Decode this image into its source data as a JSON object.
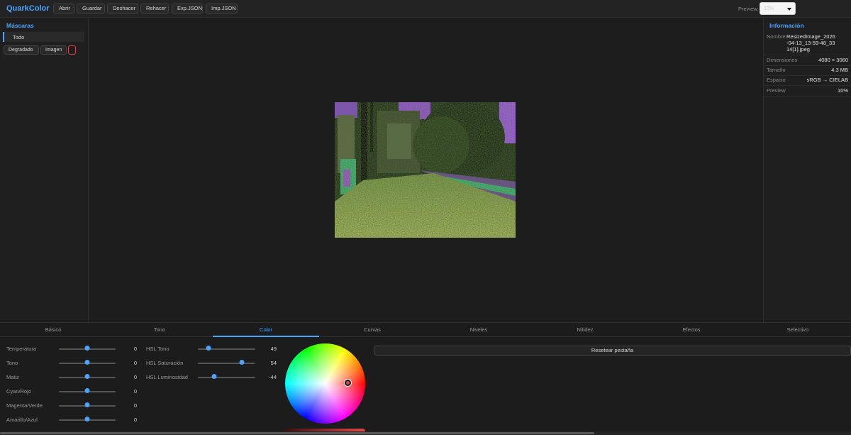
{
  "app": {
    "brand": "QuarkColor"
  },
  "toolbar": {
    "buttons": [
      "Abrir",
      "Guardar",
      "Deshacer",
      "Rehacer",
      "Exp.JSON",
      "Imp.JSON"
    ],
    "preview_label": "Preview:",
    "preview_value": "10%"
  },
  "masks": {
    "title": "Máscaras",
    "items": [
      "Todo"
    ],
    "buttons": [
      "Degradado",
      "Imagen"
    ]
  },
  "info": {
    "title": "Información",
    "rows": [
      {
        "key": "Nombre",
        "value": "ResizedImage_2026-04-13_13-59-48_3314[1].jpeg"
      },
      {
        "key": "Dimensiones",
        "value": "4080 × 3060"
      },
      {
        "key": "Tamaño",
        "value": "4.3 MB"
      },
      {
        "key": "Espacio",
        "value": "sRGB → CIELAB"
      },
      {
        "key": "Preview",
        "value": "10%"
      }
    ]
  },
  "tabs": [
    {
      "label": "Básico",
      "active": false
    },
    {
      "label": "Tono",
      "active": false
    },
    {
      "label": "Color",
      "active": true
    },
    {
      "label": "Curvas",
      "active": false
    },
    {
      "label": "Niveles",
      "active": false
    },
    {
      "label": "Nitidez",
      "active": false
    },
    {
      "label": "Efectos",
      "active": false
    },
    {
      "label": "Selectivo",
      "active": false
    }
  ],
  "color_sliders_left": [
    {
      "label": "Temperatura",
      "value": "0",
      "position": 0.5
    },
    {
      "label": "Tono",
      "value": "0",
      "position": 0.5
    },
    {
      "label": "Matiz",
      "value": "0",
      "position": 0.5
    },
    {
      "label": "Cyan/Rojo",
      "value": "0",
      "position": 0.5
    },
    {
      "label": "Magenta/Verde",
      "value": "0",
      "position": 0.5
    },
    {
      "label": "Amarillo/Azul",
      "value": "0",
      "position": 0.5
    }
  ],
  "color_sliders_hsl": [
    {
      "label": "HSL Tono",
      "value": "49",
      "position": 0.18
    },
    {
      "label": "HSL Saturación",
      "value": "54",
      "position": 0.77
    },
    {
      "label": "HSL Luminosidad",
      "value": "-44",
      "position": 0.28
    }
  ],
  "reset_button": "Resetear pestaña",
  "colors": {
    "accent": "#4aa3ff",
    "wheel_knob": "#e04848"
  }
}
